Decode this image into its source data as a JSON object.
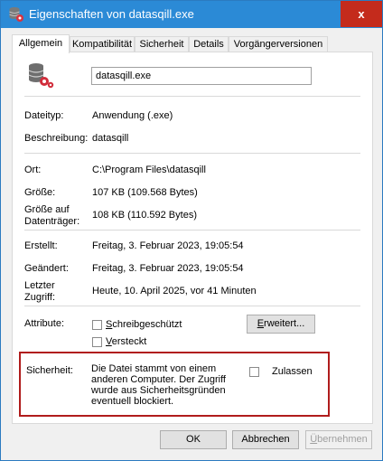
{
  "window": {
    "title": "Eigenschaften von datasqill.exe",
    "close_label": "x"
  },
  "tabs": [
    {
      "label": "Allgemein",
      "active": true
    },
    {
      "label": "Kompatibilität",
      "active": false
    },
    {
      "label": "Sicherheit",
      "active": false
    },
    {
      "label": "Details",
      "active": false
    },
    {
      "label": "Vorgängerversionen",
      "active": false
    }
  ],
  "general": {
    "file_name": "datasqill.exe",
    "type_label": "Dateityp:",
    "type_value": "Anwendung (.exe)",
    "description_label": "Beschreibung:",
    "description_value": "datasqill",
    "location_label": "Ort:",
    "location_value": "C:\\Program Files\\datasqill",
    "size_label": "Größe:",
    "size_value": "107 KB (109.568 Bytes)",
    "size_on_disk_label_1": "Größe auf",
    "size_on_disk_label_2": "Datenträger:",
    "size_on_disk_value": "108 KB (110.592 Bytes)",
    "created_label": "Erstellt:",
    "created_value": "Freitag, 3. Februar 2023, 19:05:54",
    "modified_label": "Geändert:",
    "modified_value": "Freitag, 3. Februar 2023, 19:05:54",
    "accessed_label_1": "Letzter",
    "accessed_label_2": "Zugriff:",
    "accessed_value": "Heute, 10. April 2025, vor 41 Minuten",
    "attributes_label": "Attribute:",
    "readonly_first": "S",
    "readonly_rest": "chreibgeschützt",
    "hidden_first": "V",
    "hidden_rest": "ersteckt",
    "advanced_first": "E",
    "advanced_rest": "rweitert..."
  },
  "security": {
    "label": "Sicherheit:",
    "text_line_1": "Die Datei stammt von einem",
    "text_line_2": "anderen Computer. Der Zugriff",
    "text_line_3": "wurde aus Sicherheitsgründen",
    "text_line_4": "eventuell blockiert.",
    "unblock_label": "Zulassen"
  },
  "buttons": {
    "ok": "OK",
    "cancel": "Abbrechen",
    "apply_first": "Ü",
    "apply_rest": "bernehmen"
  },
  "colors": {
    "titlebar": "#2b8ad6",
    "close": "#c42b1c",
    "security_border": "#b01c1c"
  },
  "icons": {
    "app": "database-gear-icon",
    "title": "database-gear-icon"
  }
}
